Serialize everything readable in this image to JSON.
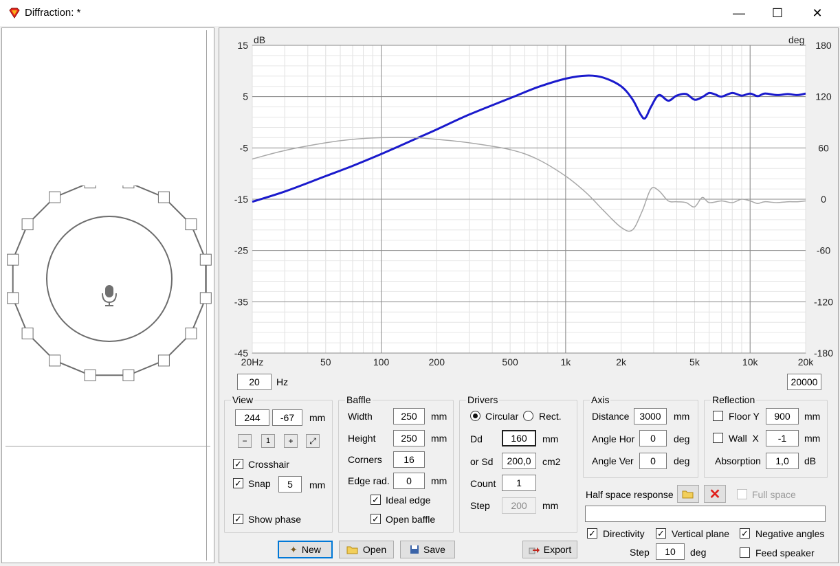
{
  "window": {
    "title": "Diffraction: *",
    "controls": [
      "—",
      "☐",
      "✕"
    ]
  },
  "chart_data": {
    "type": "line",
    "ylabel_left": "dB",
    "ylabel_right": "deg",
    "x_scale": "log",
    "xlim": [
      20,
      20000
    ],
    "ylim_left": [
      -45,
      15
    ],
    "ylim_right": [
      -180,
      180
    ],
    "x_ticks": [
      {
        "v": 20,
        "t": "20Hz"
      },
      {
        "v": 50,
        "t": "50"
      },
      {
        "v": 100,
        "t": "100"
      },
      {
        "v": 200,
        "t": "200"
      },
      {
        "v": 500,
        "t": "500"
      },
      {
        "v": 1000,
        "t": "1k"
      },
      {
        "v": 2000,
        "t": "2k"
      },
      {
        "v": 5000,
        "t": "5k"
      },
      {
        "v": 10000,
        "t": "10k"
      },
      {
        "v": 20000,
        "t": "20k"
      }
    ],
    "y_ticks_left": [
      15,
      5,
      -5,
      -15,
      -25,
      -35,
      -45
    ],
    "y_ticks_right": [
      180,
      120,
      60,
      0,
      -60,
      -120,
      -180
    ],
    "series": [
      {
        "axis": "left",
        "color": "#1a1acc",
        "x": [
          20,
          30,
          50,
          70,
          100,
          150,
          200,
          300,
          500,
          700,
          1000,
          1300,
          1600,
          2000,
          2300,
          2550,
          2700,
          2900,
          3200,
          3600,
          4000,
          4500,
          5000,
          5500,
          6000,
          6500,
          7000,
          8000,
          9000,
          10000,
          11000,
          12000,
          14000,
          16000,
          18000,
          20000
        ],
        "y": [
          -15.5,
          -13.5,
          -10.5,
          -8.5,
          -6.2,
          -3.4,
          -1.4,
          1.5,
          4.7,
          6.8,
          8.5,
          9.1,
          8.7,
          7.0,
          4.5,
          1.5,
          0.8,
          3.0,
          5.3,
          4.2,
          5.2,
          5.5,
          4.4,
          4.9,
          5.7,
          5.4,
          5.0,
          5.7,
          5.2,
          5.6,
          5.1,
          5.6,
          5.3,
          5.5,
          5.3,
          5.6
        ]
      },
      {
        "axis": "right",
        "color": "#a8a8a8",
        "x": [
          20,
          30,
          50,
          70,
          100,
          150,
          200,
          300,
          500,
          700,
          1000,
          1300,
          1600,
          2000,
          2300,
          2600,
          2900,
          3200,
          3600,
          4000,
          4500,
          5000,
          5500,
          6000,
          7000,
          8000,
          9000,
          10000,
          11000,
          12000,
          14000,
          16000,
          18000,
          20000
        ],
        "y": [
          47,
          57,
          66,
          70,
          72,
          72,
          70,
          66,
          58,
          47,
          27,
          7,
          -13,
          -33,
          -36,
          -14,
          12,
          10,
          -2,
          -3,
          -4,
          -9,
          2,
          -4,
          -2,
          -4,
          0,
          -2,
          -5,
          -3,
          -4,
          -3,
          -3,
          -2
        ]
      }
    ]
  },
  "range": {
    "min": "20",
    "unit": "Hz",
    "max": "20000"
  },
  "view": {
    "title": "View",
    "x": "244",
    "y": "-67",
    "unit": "mm",
    "crosshair": "Crosshair",
    "snap": "Snap",
    "snap_value": "5",
    "snap_unit": "mm",
    "show_phase": "Show phase"
  },
  "baffle": {
    "title": "Baffle",
    "width_label": "Width",
    "width": "250",
    "height_label": "Height",
    "height": "250",
    "corners_label": "Corners",
    "corners": "16",
    "edge_label": "Edge rad.",
    "edge": "0",
    "unit": "mm",
    "ideal_edge": "Ideal edge",
    "open_baffle": "Open baffle"
  },
  "drivers": {
    "title": "Drivers",
    "circular": "Circular",
    "rect": "Rect.",
    "dd_label": "Dd",
    "dd": "160",
    "dd_unit": "mm",
    "sd_label": "or Sd",
    "sd": "200,0",
    "sd_unit": "cm2",
    "count_label": "Count",
    "count": "1",
    "step_label": "Step",
    "step": "200",
    "step_unit": "mm"
  },
  "axis": {
    "title": "Axis",
    "distance_label": "Distance",
    "distance": "3000",
    "distance_unit": "mm",
    "hor_label": "Angle Hor",
    "hor": "0",
    "ver_label": "Angle Ver",
    "ver": "0",
    "deg": "deg"
  },
  "reflection": {
    "title": "Reflection",
    "floor_label": "Floor Y",
    "floor": "900",
    "wall_label": "Wall  X",
    "wall": "-1",
    "unit": "mm",
    "absorption_label": "Absorption",
    "absorption": "1,0",
    "absorption_unit": "dB"
  },
  "half_space": {
    "label": "Half space response",
    "full_space": "Full space",
    "path": ""
  },
  "options": {
    "directivity": "Directivity",
    "vertical_plane": "Vertical plane",
    "negative_angles": "Negative angles",
    "step_label": "Step",
    "step": "10",
    "step_unit": "deg",
    "feed_speaker": "Feed speaker"
  },
  "buttons": {
    "new": "New",
    "open": "Open",
    "save": "Save",
    "export": "Export"
  },
  "colors": {
    "response": "#1a1acc",
    "phase": "#a8a8a8",
    "accent": "#0078d7"
  }
}
